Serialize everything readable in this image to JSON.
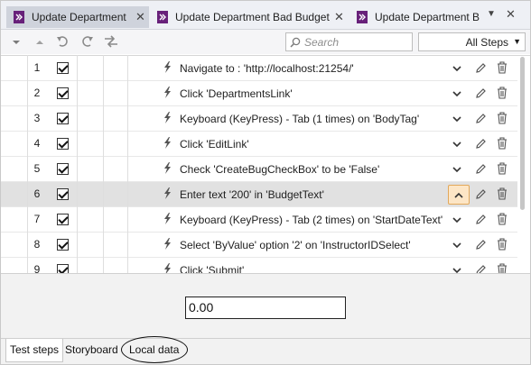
{
  "tabs": [
    {
      "label": "Update Department",
      "active": true
    },
    {
      "label": "Update Department Bad Budget",
      "active": false
    },
    {
      "label": "Update Department Ba",
      "active": false
    }
  ],
  "toolbar": {
    "search_placeholder": "Search",
    "steps_filter": "All Steps"
  },
  "steps": [
    {
      "num": "1",
      "checked": true,
      "text": "Navigate to : 'http://localhost:21254/'"
    },
    {
      "num": "2",
      "checked": true,
      "text": "Click 'DepartmentsLink'"
    },
    {
      "num": "3",
      "checked": true,
      "text": "Keyboard (KeyPress) - Tab (1 times) on 'BodyTag'"
    },
    {
      "num": "4",
      "checked": true,
      "text": "Click 'EditLink'"
    },
    {
      "num": "5",
      "checked": true,
      "text": "Check 'CreateBugCheckBox' to be 'False'"
    },
    {
      "num": "6",
      "checked": true,
      "text": "Enter text '200' in 'BudgetText'",
      "selected": true
    },
    {
      "num": "7",
      "checked": true,
      "text": "Keyboard (KeyPress) - Tab (2 times) on 'StartDateText'"
    },
    {
      "num": "8",
      "checked": true,
      "text": "Select 'ByValue' option '2' on 'InstructorIDSelect'"
    },
    {
      "num": "9",
      "checked": true,
      "text": "Click 'Submit'"
    }
  ],
  "local_data": {
    "value": "0.00"
  },
  "bottom_tabs": [
    "Test steps",
    "Storyboard",
    "Local data"
  ],
  "colors": {
    "accent": "#68217a",
    "selected_row": "#e1e1e1",
    "expand_highlight": "#fde6c6"
  }
}
